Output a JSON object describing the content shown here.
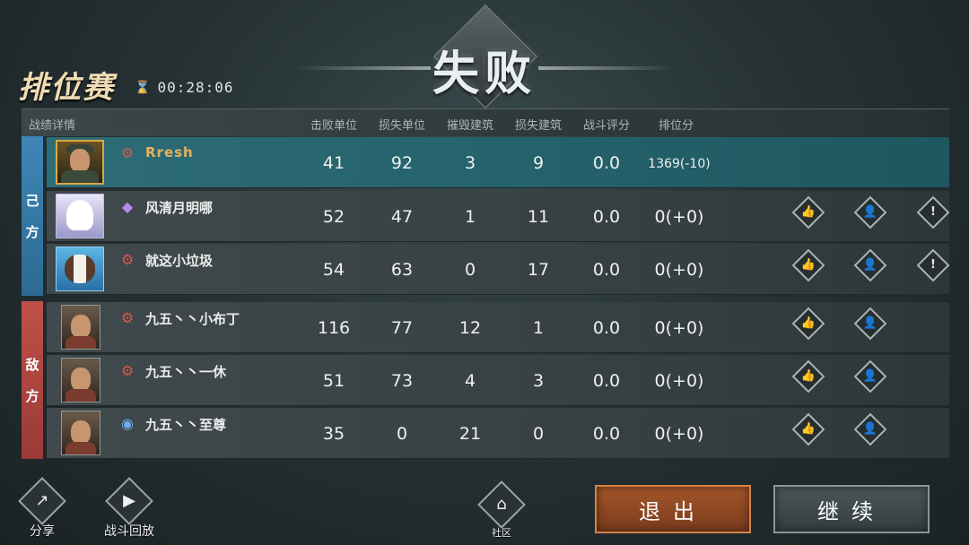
{
  "header": {
    "result": "失败",
    "mode": "排位赛",
    "timer_icon": "hourglass-icon",
    "timer": "00:28:06"
  },
  "table": {
    "columns": [
      "战绩详情",
      "击败单位",
      "损失单位",
      "摧毁建筑",
      "损失建筑",
      "战斗评分",
      "排位分"
    ],
    "ally_label": [
      "己",
      "方"
    ],
    "enemy_label": [
      "敌",
      "方"
    ],
    "players": [
      {
        "name": "Rresh",
        "rank_icon": "rank-red-icon",
        "kills": "41",
        "lost": "92",
        "destroyed": "3",
        "buildings_lost": "9",
        "score": "0.0",
        "rank_points": "1369(-10)",
        "self": true
      },
      {
        "name": "风清月明哪",
        "rank_icon": "rank-purple-icon",
        "kills": "52",
        "lost": "47",
        "destroyed": "1",
        "buildings_lost": "11",
        "score": "0.0",
        "rank_points": "0(+0)"
      },
      {
        "name": "就这小垃圾",
        "rank_icon": "rank-red-icon",
        "kills": "54",
        "lost": "63",
        "destroyed": "0",
        "buildings_lost": "17",
        "score": "0.0",
        "rank_points": "0(+0)"
      },
      {
        "name": "九五丶丶小布丁",
        "rank_icon": "rank-red-icon",
        "kills": "116",
        "lost": "77",
        "destroyed": "12",
        "buildings_lost": "1",
        "score": "0.0",
        "rank_points": "0(+0)"
      },
      {
        "name": "九五丶丶一休",
        "rank_icon": "rank-red-icon",
        "kills": "51",
        "lost": "73",
        "destroyed": "4",
        "buildings_lost": "3",
        "score": "0.0",
        "rank_points": "0(+0)"
      },
      {
        "name": "九五丶丶至尊",
        "rank_icon": "rank-blue-icon",
        "kills": "35",
        "lost": "0",
        "destroyed": "21",
        "buildings_lost": "0",
        "score": "0.0",
        "rank_points": "0(+0)"
      }
    ]
  },
  "bottom": {
    "share": "分享",
    "replay": "战斗回放",
    "community": "社区",
    "exit": "退出",
    "continue": "继续"
  }
}
